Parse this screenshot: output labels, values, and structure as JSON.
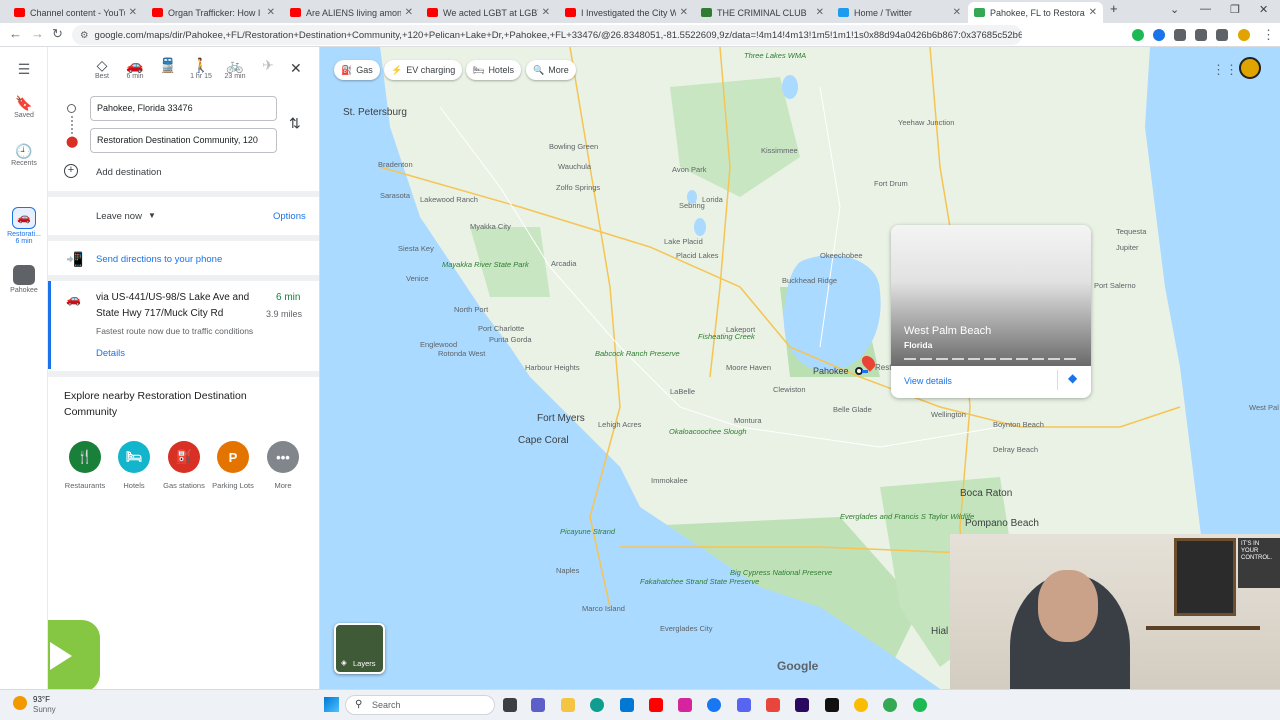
{
  "browser": {
    "tabs": [
      {
        "title": "Channel content - YouTube",
        "fav": "#ff0000"
      },
      {
        "title": "Organ Trafficker: How I Ge",
        "fav": "#ff0000"
      },
      {
        "title": "Are ALIENS living among u",
        "fav": "#ff0000"
      },
      {
        "title": "We acted LGBT at LGBT Ch",
        "fav": "#ff0000"
      },
      {
        "title": "I Investigated the City Whe",
        "fav": "#ff0000"
      },
      {
        "title": "THE CRIMINAL CLUB",
        "fav": "#2e7d32"
      },
      {
        "title": "Home / Twitter",
        "fav": "#1d9bf0"
      },
      {
        "title": "Pahokee, FL to Restoratio",
        "fav": "#34a853"
      }
    ],
    "url": "google.com/maps/dir/Pahokee,+FL/Restoration+Destination+Community,+120+Pelican+Lake+Dr,+Pahokee,+FL+33476/@26.8348051,-81.5522609,9z/data=!4m14!4m13!1m5!1m1!1s0x88d94a0426b6b867:0x37685c52b68...",
    "new_tab": "+"
  },
  "rail": {
    "menu_icon": "menu-icon",
    "saved": "Saved",
    "recents": "Recents",
    "active_trip_line1": "Restorati...",
    "active_trip_line2": "6 min",
    "pahokee": "Pahokee"
  },
  "modes": [
    {
      "label": "Best",
      "icon": "◇"
    },
    {
      "label": "6 min",
      "icon": "🚗"
    },
    {
      "label": "",
      "icon": "🚆"
    },
    {
      "label": "1 hr 15",
      "icon": "🚶"
    },
    {
      "label": "23 min",
      "icon": "🚲"
    },
    {
      "label": "",
      "icon": "✈"
    }
  ],
  "directions": {
    "origin": "Pahokee, Florida 33476",
    "destination": "Restoration Destination Community, 120",
    "add_destination": "Add destination",
    "leave_now": "Leave now",
    "options": "Options",
    "send_to_phone": "Send directions to your phone",
    "route_title_line1": "via US-441/US-98/S Lake Ave and",
    "route_title_line2": "State Hwy 717/Muck City Rd",
    "route_time": "6 min",
    "route_distance": "3.9 miles",
    "route_note": "Fastest route now due to traffic conditions",
    "details": "Details"
  },
  "explore": {
    "title_line1": "Explore nearby Restoration Destination",
    "title_line2": "Community",
    "categories": [
      {
        "label": "Restaurants",
        "icon": "🍴",
        "color": "#188038"
      },
      {
        "label": "Hotels",
        "icon": "🛏",
        "color": "#12b5cb"
      },
      {
        "label": "Gas stations",
        "icon": "⛽",
        "color": "#d93025"
      },
      {
        "label": "Parking Lots",
        "icon": "P",
        "color": "#e37400"
      },
      {
        "label": "More",
        "icon": "•••",
        "color": "#80868b"
      }
    ]
  },
  "map_chips": [
    {
      "label": "Gas",
      "icon": "⛽"
    },
    {
      "label": "EV charging",
      "icon": "⚡"
    },
    {
      "label": "Hotels",
      "icon": "🛏"
    },
    {
      "label": "More",
      "icon": "🔍"
    }
  ],
  "map_labels": {
    "big": [
      "St. Petersburg",
      "Fort Myers",
      "Cape Coral",
      "Boca Raton",
      "Pompano Beach",
      "Pahokee",
      "Hial"
    ],
    "towns": [
      "Bowling Green",
      "Zolfo Springs",
      "Wauchula",
      "Arcadia",
      "Lake Placid",
      "Placid Lakes",
      "Sebring",
      "Avon Park",
      "Okeechobee",
      "Kissimmee",
      "Lorida",
      "Port Charlotte",
      "North Port",
      "Venice",
      "Sarasota",
      "Bradenton",
      "Lakewood Ranch",
      "Myakka City",
      "Siesta Key",
      "Punta Gorda",
      "Englewood",
      "Rotonda West",
      "Lehigh Acres",
      "LaBelle",
      "Clewiston",
      "Moore Haven",
      "Belle Glade",
      "Wellington",
      "Boynton Beach",
      "Delray Beach",
      "Montura",
      "Immokalee",
      "Naples",
      "Marco Island",
      "Everglades City",
      "Lakeport",
      "Buckhead Ridge",
      "Yeehaw Junction",
      "Fort Drum",
      "Harbour Heights",
      "Port Salerno",
      "Jupiter",
      "Tequesta",
      "Three Lakes WMA",
      "Fisheating Creek",
      "Mayakka River State Park",
      "Babcock Ranch Preserve",
      "Okaloacoochee Slough",
      "Fakahatchee Strand State Preserve",
      "Big Cypress National Preserve",
      "Everglades and Francis S Taylor Wildlife",
      "Picayune Strand",
      "Restoration",
      "West Pal"
    ],
    "resto_marker_label": "Res Com"
  },
  "place_card": {
    "title": "West Palm Beach",
    "subtitle": "Florida",
    "view_details": "View details"
  },
  "map_footer": {
    "layers": "Layers",
    "google": "Google"
  },
  "taskbar": {
    "weather_temp": "93°F",
    "weather_desc": "Sunny",
    "search": "Search"
  },
  "webcam": {
    "sign_text": "IT'S IN YOUR CONTROL."
  }
}
